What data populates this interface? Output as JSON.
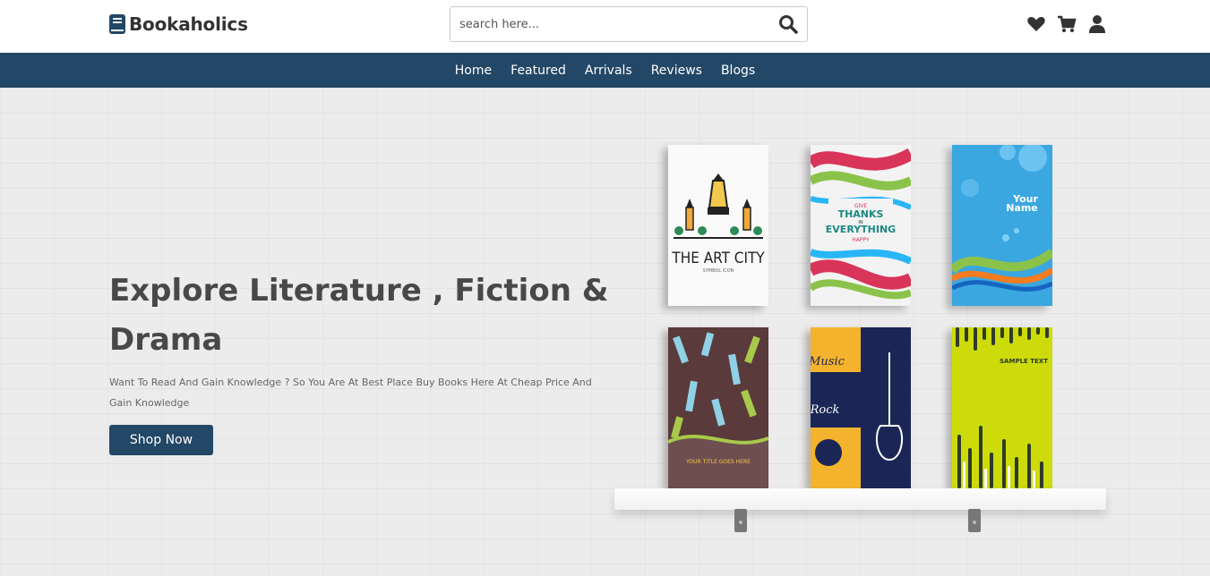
{
  "header": {
    "logo_text": "Bookaholics",
    "search_placeholder": "search here...",
    "icons": [
      "heart-icon",
      "cart-icon",
      "user-icon"
    ]
  },
  "nav": {
    "items": [
      "Home",
      "Featured",
      "Arrivals",
      "Reviews",
      "Blogs"
    ]
  },
  "hero": {
    "title": "Explore Literature , Fiction & Drama",
    "description": "Want To Read And Gain Knowledge ? So You Are At Best Place Buy Books Here At Cheap Price And Gain Knowledge",
    "button_label": "Shop Now"
  },
  "books": {
    "art_city": {
      "title": "THE ART CITY",
      "subtitle": "SYMBOL ICON"
    },
    "thanks": {
      "line1": "GIVE",
      "line2": "THANKS",
      "line3": "IN",
      "line4": "EVERYTHING",
      "line5": "HAPPY"
    },
    "your_name": {
      "text1": "Your",
      "text2": "Name"
    },
    "hands": {
      "text": "YOUR TITLE GOES HERE"
    },
    "music": {
      "text1": "Music",
      "text2": "Rock"
    },
    "sample": {
      "text": "SAMPLE TEXT"
    }
  },
  "colors": {
    "brand": "#234766",
    "heading": "#484848"
  }
}
